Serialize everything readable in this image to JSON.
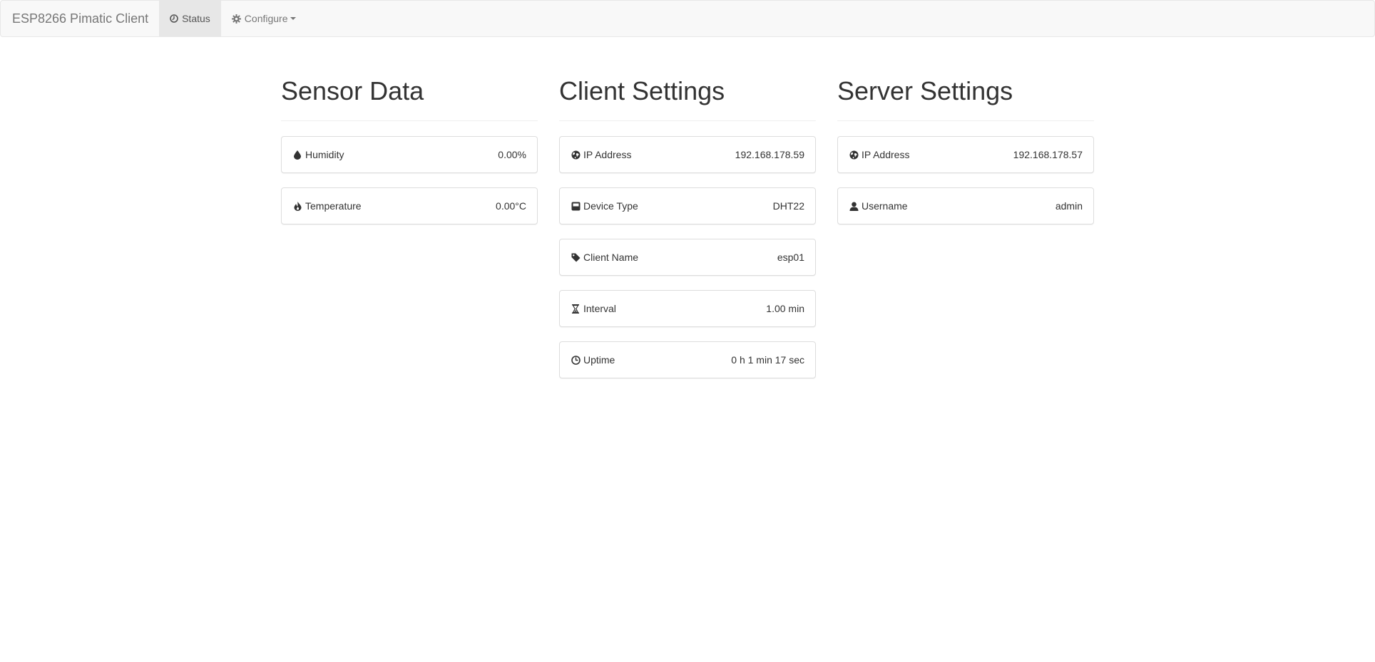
{
  "navbar": {
    "brand": "ESP8266 Pimatic Client",
    "status_label": "Status",
    "configure_label": "Configure"
  },
  "sensor": {
    "title": "Sensor Data",
    "items": [
      {
        "label": "Humidity",
        "value": "0.00%",
        "icon": "tint-icon"
      },
      {
        "label": "Temperature",
        "value": "0.00°C",
        "icon": "fire-icon"
      }
    ]
  },
  "client": {
    "title": "Client Settings",
    "items": [
      {
        "label": "IP Address",
        "value": "192.168.178.59",
        "icon": "globe-icon"
      },
      {
        "label": "Device Type",
        "value": "DHT22",
        "icon": "inbox-icon"
      },
      {
        "label": "Client Name",
        "value": "esp01",
        "icon": "tag-icon"
      },
      {
        "label": "Interval",
        "value": "1.00 min",
        "icon": "hourglass-icon"
      },
      {
        "label": "Uptime",
        "value": "0 h 1 min 17 sec",
        "icon": "clock-icon"
      }
    ]
  },
  "server": {
    "title": "Server Settings",
    "items": [
      {
        "label": "IP Address",
        "value": "192.168.178.57",
        "icon": "globe-icon"
      },
      {
        "label": "Username",
        "value": "admin",
        "icon": "user-icon"
      }
    ]
  }
}
